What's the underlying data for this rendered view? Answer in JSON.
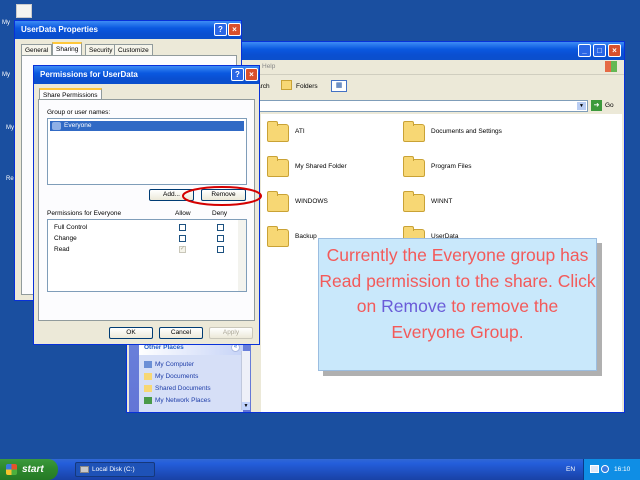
{
  "desktop": {
    "icons": [
      {
        "name": "My Documents",
        "label": "My"
      },
      {
        "name": "My Computer",
        "label": "My"
      },
      {
        "name": "My Network",
        "label": "My"
      },
      {
        "name": "Recycle Bin",
        "label": "Re"
      }
    ]
  },
  "explorer": {
    "title_partial": "Help",
    "address_go": "Go",
    "toolbar": {
      "search": "arch",
      "folders": "Folders"
    },
    "folders": [
      "ATI",
      "Documents and Settings",
      "My Shared Folder",
      "Program Files",
      "WINDOWS",
      "WINNT",
      "Backup",
      "UserData"
    ],
    "other_places": {
      "heading": "Other Places",
      "links": [
        "My Computer",
        "My Documents",
        "Shared Documents",
        "My Network Places"
      ]
    }
  },
  "properties": {
    "title": "UserData Properties",
    "tabs": [
      "General",
      "Sharing",
      "Security",
      "Customize"
    ],
    "active_tab": "Sharing"
  },
  "permissions": {
    "title": "Permissions for UserData",
    "tab": "Share Permissions",
    "group_label": "Group or user names:",
    "groups": [
      "Everyone"
    ],
    "add_label": "Add...",
    "remove_label": "Remove",
    "perm_header": "Permissions for Everyone",
    "allow_label": "Allow",
    "deny_label": "Deny",
    "rows": [
      {
        "name": "Full Control",
        "allow": false,
        "deny": false
      },
      {
        "name": "Change",
        "allow": false,
        "deny": false
      },
      {
        "name": "Read",
        "allow": true,
        "deny": false
      }
    ],
    "ok_label": "OK",
    "cancel_label": "Cancel",
    "apply_label": "Apply"
  },
  "callout": {
    "part1": "Currently the Everyone group has Read permission to the share. Click on",
    "keyword": "Remove",
    "part2": "to remove the Everyone Group."
  },
  "taskbar": {
    "start": "start",
    "task": "Local Disk (C:)",
    "lang": "EN",
    "clock": "16:10"
  },
  "colors": {
    "desktop": "#1a4fa0",
    "callout_text": "#f35a5a",
    "callout_keyword": "#6a5cd8",
    "highlight_circle": "#d40000"
  }
}
